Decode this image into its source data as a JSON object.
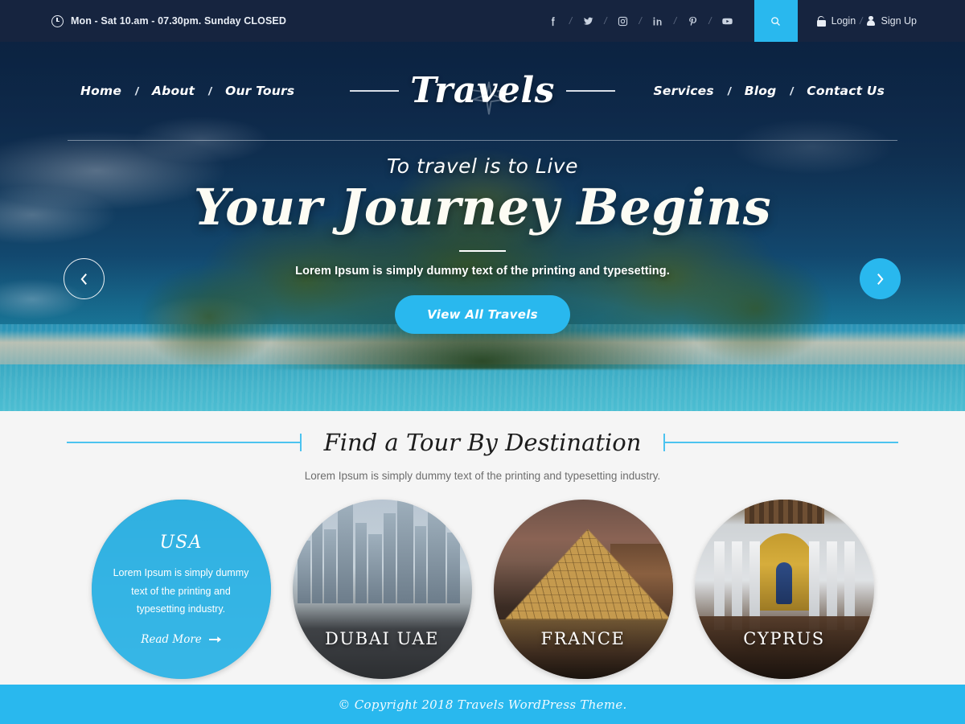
{
  "topbar": {
    "hours": "Mon - Sat 10.am - 07.30pm. Sunday CLOSED",
    "clock_icon": "clock-icon",
    "socials": [
      {
        "name": "facebook-icon",
        "label": "f"
      },
      {
        "name": "twitter-icon",
        "label": "t"
      },
      {
        "name": "instagram-icon",
        "label": "ig"
      },
      {
        "name": "linkedin-icon",
        "label": "in"
      },
      {
        "name": "pinterest-icon",
        "label": "p"
      },
      {
        "name": "youtube-icon",
        "label": "yt"
      }
    ],
    "separator": "/",
    "search_icon": "search-icon",
    "login_label": "Login",
    "login_icon": "unlock-icon",
    "signup_label": "Sign Up",
    "signup_icon": "user-icon"
  },
  "nav": {
    "left_links": [
      "Home",
      "About",
      "Our Tours"
    ],
    "right_links": [
      "Services",
      "Blog",
      "Contact Us"
    ],
    "separator": "/",
    "logo": "Travels",
    "logo_icon": "airplane-icon"
  },
  "hero": {
    "kicker": "To travel is to Live",
    "title": "Your Journey Begins",
    "subtitle": "Lorem Ipsum is simply dummy text of the printing and typesetting.",
    "cta_label": "View All Travels",
    "prev_icon": "chevron-left-icon",
    "next_icon": "chevron-right-icon"
  },
  "destinations": {
    "title": "Find a Tour By Destination",
    "subtitle": "Lorem Ipsum is simply dummy text of the printing and typesetting industry.",
    "cards": [
      {
        "name": "USA",
        "description": "Lorem Ipsum is simply dummy text of the printing and typesetting industry.",
        "read_more": "Read More",
        "read_more_icon": "arrow-right-icon",
        "active": true
      },
      {
        "name": "DUBAI UAE",
        "active": false
      },
      {
        "name": "FRANCE",
        "active": false
      },
      {
        "name": "CYPRUS",
        "active": false
      }
    ]
  },
  "footer": {
    "copyright": "© Copyright 2018 Travels WordPress Theme."
  },
  "colors": {
    "accent": "#29b8ee",
    "topbar_bg": "#16243f",
    "section_bg": "#f5f5f5",
    "title_text": "#1c1c1c"
  }
}
